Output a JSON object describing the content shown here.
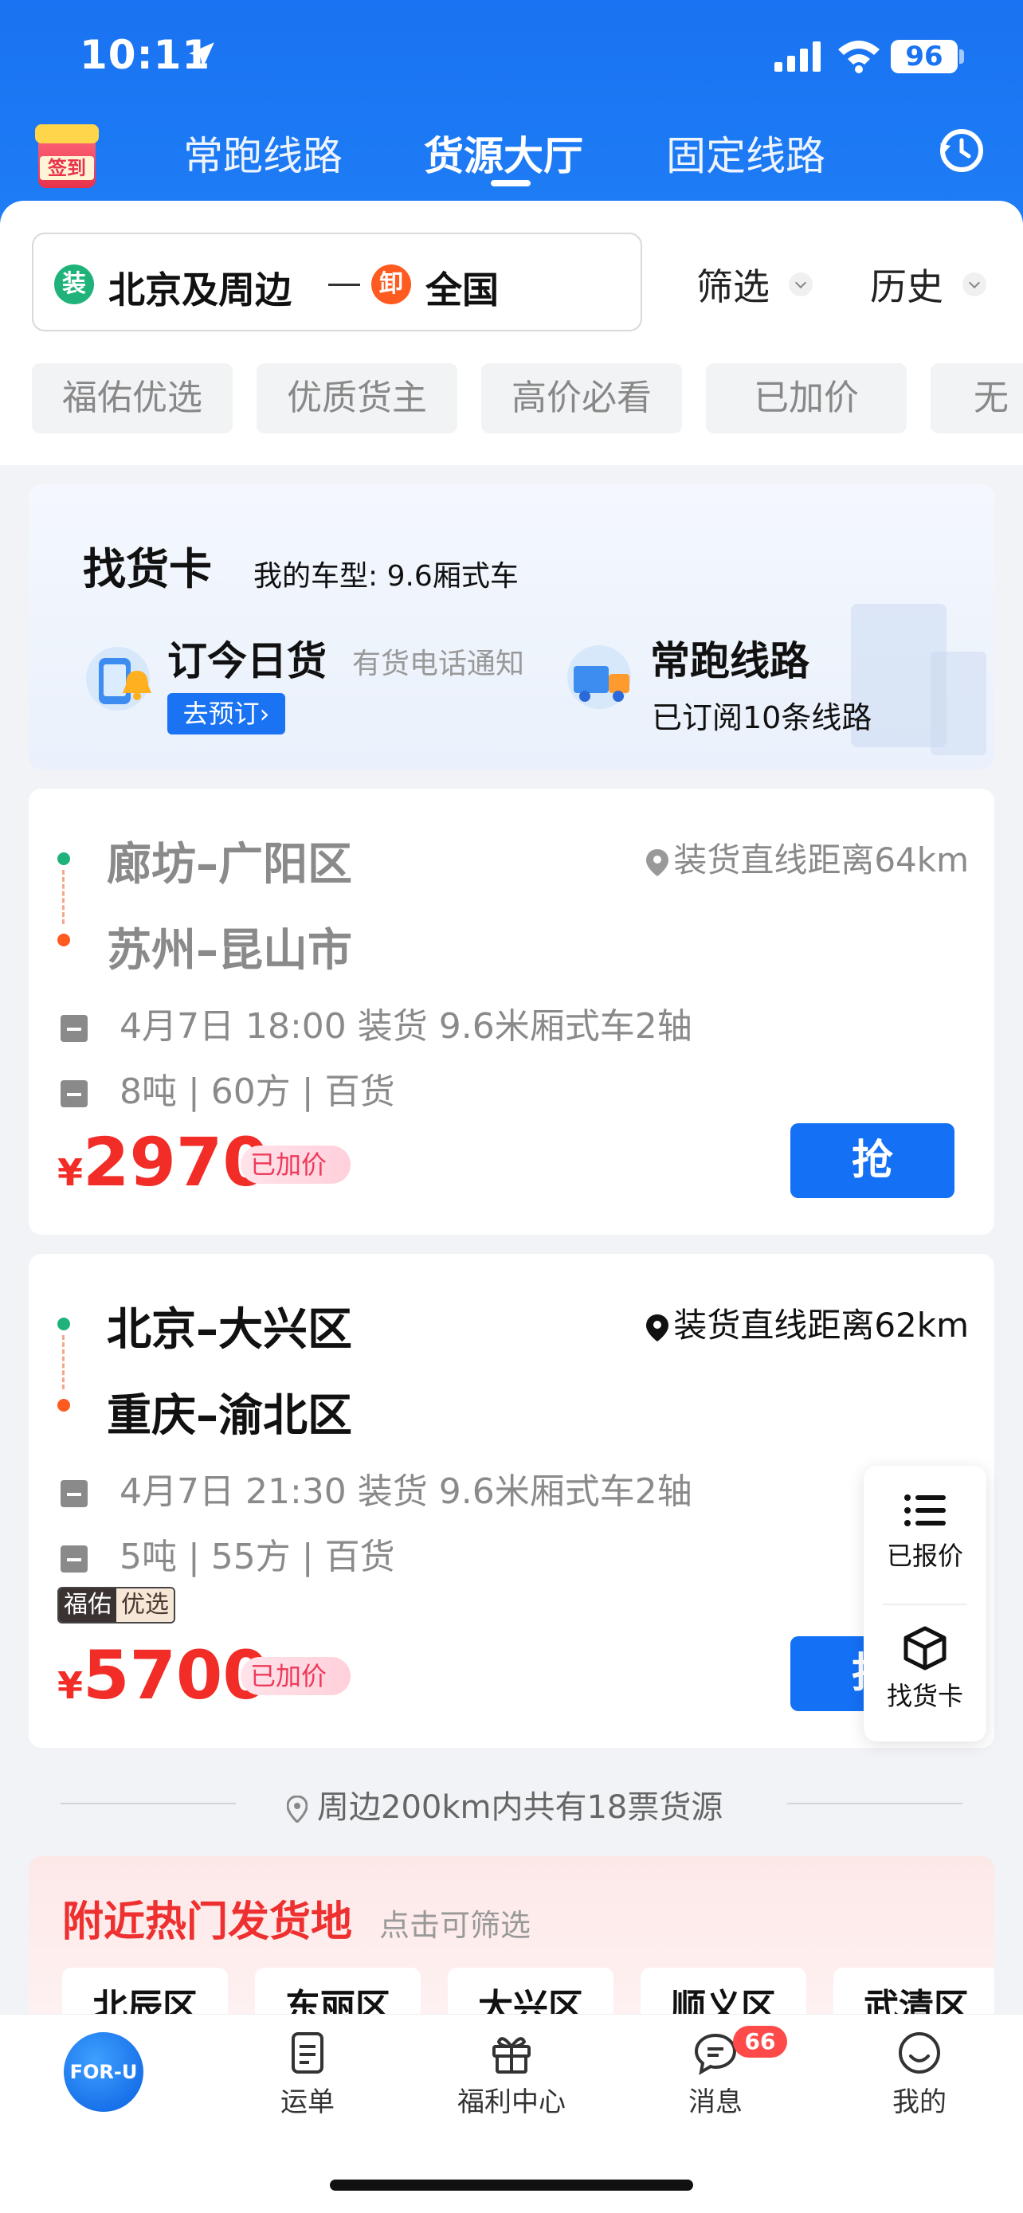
{
  "status_bar": {
    "time": "10:11",
    "battery": "96"
  },
  "header": {
    "sign_in_label": "签到",
    "tabs": [
      {
        "label": "常跑线路",
        "active": false
      },
      {
        "label": "货源大厅",
        "active": true
      },
      {
        "label": "固定线路",
        "active": false
      }
    ],
    "history_icon": "clock-icon"
  },
  "search": {
    "load_badge": "装",
    "from": "北京及周边",
    "unload_badge": "卸",
    "to": "全国",
    "filter_label": "筛选",
    "history_label": "历史"
  },
  "chips": [
    "福佑优选",
    "优质货主",
    "高价必看",
    "已加价",
    "无"
  ],
  "find_card": {
    "title": "找货卡",
    "vehicle_text": "我的车型: 9.6厢式车",
    "daily": {
      "title": "订今日货",
      "note": "有货电话通知",
      "button": "去预订›"
    },
    "routes": {
      "title": "常跑线路",
      "desc": "已订阅10条线路"
    }
  },
  "orders": [
    {
      "from": "廊坊–广阳区",
      "to": "苏州–昆山市",
      "distance": "装货直线距离64km",
      "time_info": "4月7日 18:00 装货 9.6米厢式车2轴",
      "cargo_info": "8吨 | 60方 | 百货",
      "currency": "¥",
      "price": "2970",
      "raised": "已加价",
      "action": "抢",
      "viewed": true
    },
    {
      "from": "北京–大兴区",
      "to": "重庆–渝北区",
      "distance": "装货直线距离62km",
      "time_info": "4月7日 21:30 装货 9.6米厢式车2轴",
      "cargo_info": "5吨 | 55方 | 百货",
      "tag_a": "福佑",
      "tag_b": "优选",
      "currency": "¥",
      "price": "5700",
      "raised": "已加价",
      "action": "抢",
      "viewed": false
    }
  ],
  "float_panel": {
    "quoted": "已报价",
    "find_card": "找货卡"
  },
  "nearby_summary": "周边200km内共有18票货源",
  "hot_origins": {
    "title": "附近热门发货地",
    "subtitle": "点击可筛选",
    "items": [
      "北辰区",
      "东丽区",
      "大兴区",
      "顺义区",
      "武清区"
    ]
  },
  "bottom_nav": {
    "home": "FOR-U",
    "items": [
      {
        "label": "运单",
        "icon": "document-icon"
      },
      {
        "label": "福利中心",
        "icon": "gift-icon"
      },
      {
        "label": "消息",
        "icon": "chat-icon",
        "badge": "66"
      },
      {
        "label": "我的",
        "icon": "smile-icon"
      }
    ]
  },
  "colors": {
    "brand": "#1a73f2",
    "price": "#f22c27",
    "hot": "#ee3030"
  }
}
